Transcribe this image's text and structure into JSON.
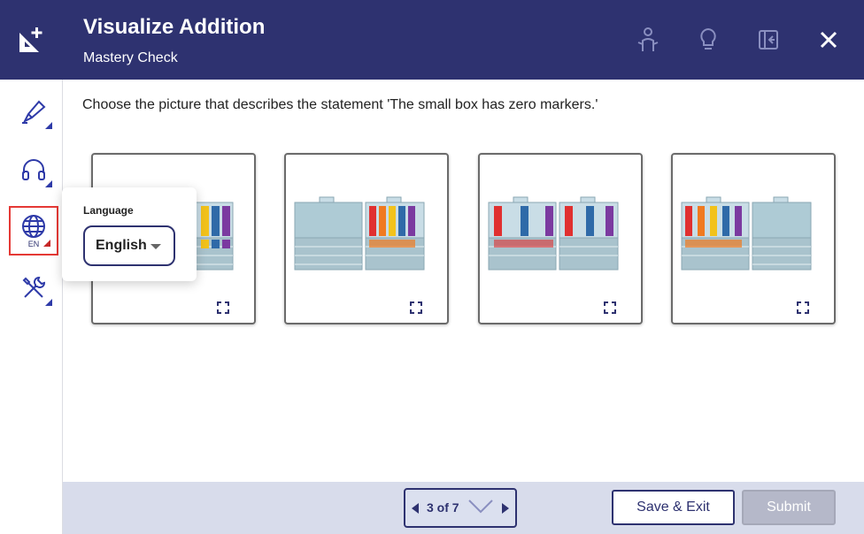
{
  "header": {
    "title": "Visualize Addition",
    "subtitle": "Mastery Check"
  },
  "sidebar": {
    "items": [
      {
        "icon": "highlighter-icon"
      },
      {
        "icon": "headphones-icon"
      },
      {
        "icon": "globe-icon",
        "label": "EN",
        "active": true
      },
      {
        "icon": "tools-icon"
      }
    ]
  },
  "question": {
    "text": "Choose the picture that describes the statement 'The small box has zero markers.'"
  },
  "language_popover": {
    "label": "Language",
    "selected": "English"
  },
  "footer": {
    "pager_text": "3 of 7",
    "save_label": "Save & Exit",
    "submit_label": "Submit"
  },
  "colors": {
    "header_bg": "#2e3270",
    "accent": "#2e3270",
    "footer_bg": "#d8dceb",
    "active_outline": "#e53935"
  }
}
